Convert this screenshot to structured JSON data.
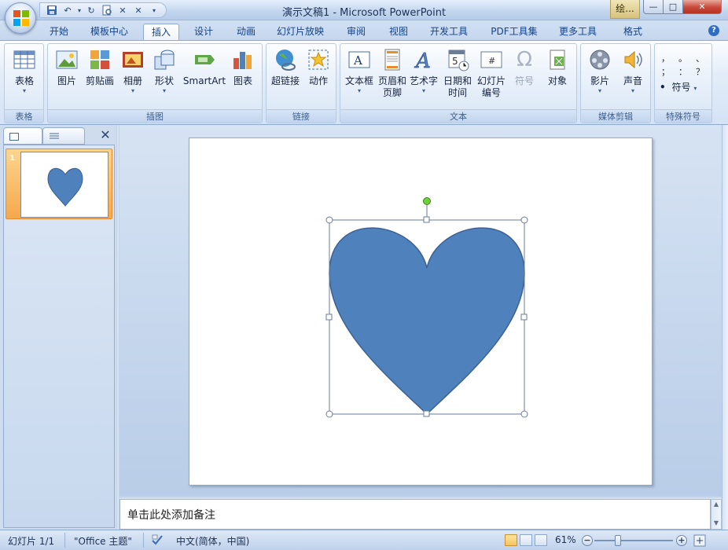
{
  "title": "演示文稿1 - Microsoft PowerPoint",
  "context_tab": "绘...",
  "window_controls": {
    "minimize": "—",
    "maximize": "□",
    "close": "✕"
  },
  "qat": {
    "undo_label": "↶",
    "redo_label": "↻",
    "extra1": "✕",
    "extra2": "✕",
    "more": "▾"
  },
  "tabs": [
    "开始",
    "模板中心",
    "插入",
    "设计",
    "动画",
    "幻灯片放映",
    "审阅",
    "视图",
    "开发工具",
    "PDF工具集",
    "更多工具",
    "格式"
  ],
  "active_tab": "插入",
  "help_label": "?",
  "ribbon": {
    "groups": [
      "表格",
      "插图",
      "链接",
      "文本",
      "媒体剪辑",
      "特殊符号"
    ],
    "buttons": {
      "table": "表格",
      "picture": "图片",
      "clipart": "剪贴画",
      "album": "相册",
      "shapes": "形状",
      "smartart": "SmartArt",
      "chart": "图表",
      "hyperlink": "超链接",
      "action": "动作",
      "textbox": "文本框",
      "header_footer_1": "页眉和",
      "header_footer_2": "页脚",
      "wordart": "艺术字",
      "datetime_1": "日期和",
      "datetime_2": "时间",
      "slide_number_1": "幻灯片",
      "slide_number_2": "编号",
      "symbol": "符号",
      "object": "对象",
      "movie": "影片",
      "sound": "声音",
      "special_symbol": "符号"
    },
    "special_symbols": [
      "，",
      "。",
      "、",
      "；",
      "：",
      "？"
    ],
    "dropdown_glyph": "▾"
  },
  "slides": [
    {
      "number": "1",
      "shape": "heart"
    }
  ],
  "heart": {
    "fill": "#4f81bd",
    "stroke": "#3c6192"
  },
  "notes_placeholder": "单击此处添加备注",
  "status": {
    "slide_info": "幻灯片 1/1",
    "theme": "\"Office 主题\"",
    "language": "中文(简体，中国)",
    "zoom": "61%",
    "zoom_minus": "−",
    "zoom_plus": "+"
  },
  "colors": {
    "accent": "#4f81bd",
    "ribbon_bg": "#dbe7f6",
    "thumb_selected": "#f6a84b"
  }
}
